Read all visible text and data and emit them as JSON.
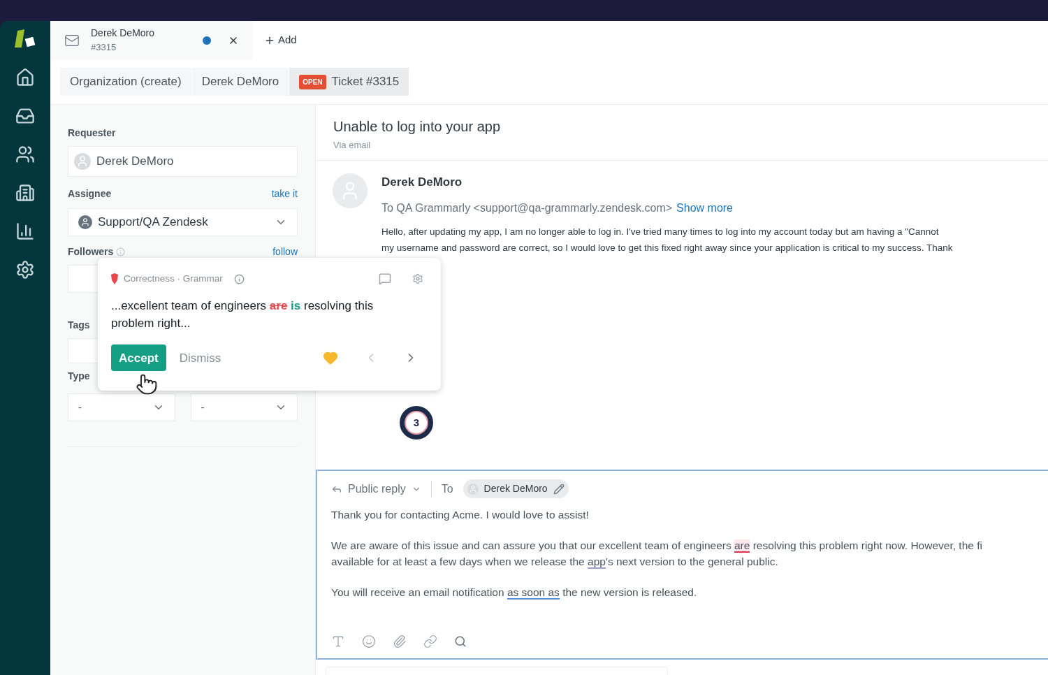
{
  "top_tabs": [
    {
      "title": "Derek DeMoro",
      "subtitle": "#3315",
      "unread": true
    }
  ],
  "add_tab": "Add",
  "sub_tabs": [
    {
      "label": "Organization (create)",
      "selected": false
    },
    {
      "label": "Derek DeMoro",
      "selected": false
    },
    {
      "label": "Ticket #3315",
      "badge": "OPEN",
      "selected": true
    }
  ],
  "properties": {
    "requester_label": "Requester",
    "requester": "Derek DeMoro",
    "assignee_label": "Assignee",
    "take_it": "take it",
    "assignee": "Support/QA Zendesk",
    "followers_label": "Followers",
    "follow": "follow",
    "tags_label": "Tags",
    "type_label": "Type",
    "type_value": "-",
    "priority_value": "-"
  },
  "ticket": {
    "subject": "Unable to log into your app",
    "channel": "Via email"
  },
  "message": {
    "author": "Derek DeMoro",
    "to": "To QA Grammarly <support@qa-grammarly.zendesk.com>",
    "show_more": "Show more",
    "body_lines": [
      "Hello, after updating my app, I am no longer able to log in. I've tried many times to log into my account today but am having a \"Cannot",
      "my username and password are correct, so I would love to get this fixed right away since your application is critical to my success. Thank"
    ]
  },
  "suggestion": {
    "category": "Correctness · Grammar",
    "before": "...excellent team of engineers",
    "removed": "are",
    "inserted": "is",
    "after": "resolving this problem right...",
    "accept": "Accept",
    "dismiss": "Dismiss"
  },
  "suggestion_badge": {
    "count": "3"
  },
  "reply": {
    "mode": "Public reply",
    "to_label": "To",
    "recipient": "Derek DeMoro",
    "paragraphs": [
      [
        [
          {
            "text": "Thank you for contacting Acme. I would love to assist!",
            "kind": "plain"
          }
        ]
      ],
      [
        [
          {
            "text": "We are aware of this issue and can assure you that our excellent team of engineers ",
            "kind": "plain"
          },
          {
            "text": "are",
            "kind": "correctness"
          },
          {
            "text": " resolving this problem right now. However, the fi",
            "kind": "plain"
          }
        ],
        [
          {
            "text": "available for at least a few days when we release the ",
            "kind": "plain"
          },
          {
            "text": "app",
            "kind": "engagement"
          },
          {
            "text": "'s next version to the general public.",
            "kind": "plain"
          }
        ]
      ],
      [
        [
          {
            "text": "You will receive an email notification ",
            "kind": "plain"
          },
          {
            "text": "as soon as",
            "kind": "clarity"
          },
          {
            "text": " the new version is released.",
            "kind": "plain"
          }
        ]
      ]
    ]
  }
}
